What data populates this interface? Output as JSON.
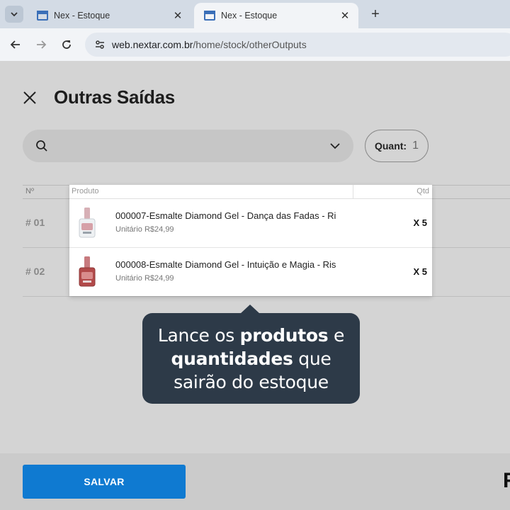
{
  "browser": {
    "tabs": [
      {
        "title": "Nex - Estoque",
        "active": false
      },
      {
        "title": "Nex - Estoque",
        "active": true
      }
    ],
    "url_host": "web.nextar.com.br",
    "url_path": "/home/stock/otherOutputs"
  },
  "page": {
    "title": "Outras Saídas",
    "search": {
      "placeholder": ""
    },
    "quant": {
      "label": "Quant:",
      "value": "1"
    },
    "table": {
      "col_no": "Nº",
      "rows": [
        "# 01",
        "# 02"
      ]
    }
  },
  "dropdown": {
    "col_product": "Produto",
    "col_qty": "Qtd",
    "items": [
      {
        "name": "000007-Esmalte Diamond Gel - Dança das Fadas - Ri",
        "price": "Unitário R$24,99",
        "qty": "X 5",
        "bottle_color": "#d6a1a8"
      },
      {
        "name": "000008-Esmalte Diamond Gel - Intuição e Magia - Ris",
        "price": "Unitário R$24,99",
        "qty": "X 5",
        "bottle_color": "#b24a4a"
      }
    ]
  },
  "tooltip": {
    "t1": "Lance os ",
    "b1": "produtos",
    "t2": " e",
    "b2": "quantidades",
    "t3": " que",
    "t4": "sairão do estoque"
  },
  "footer": {
    "save_label": "SALVAR",
    "cut_text": "R"
  },
  "colors": {
    "accent": "#0f7ad1",
    "tooltip_bg": "#2d3a48"
  }
}
